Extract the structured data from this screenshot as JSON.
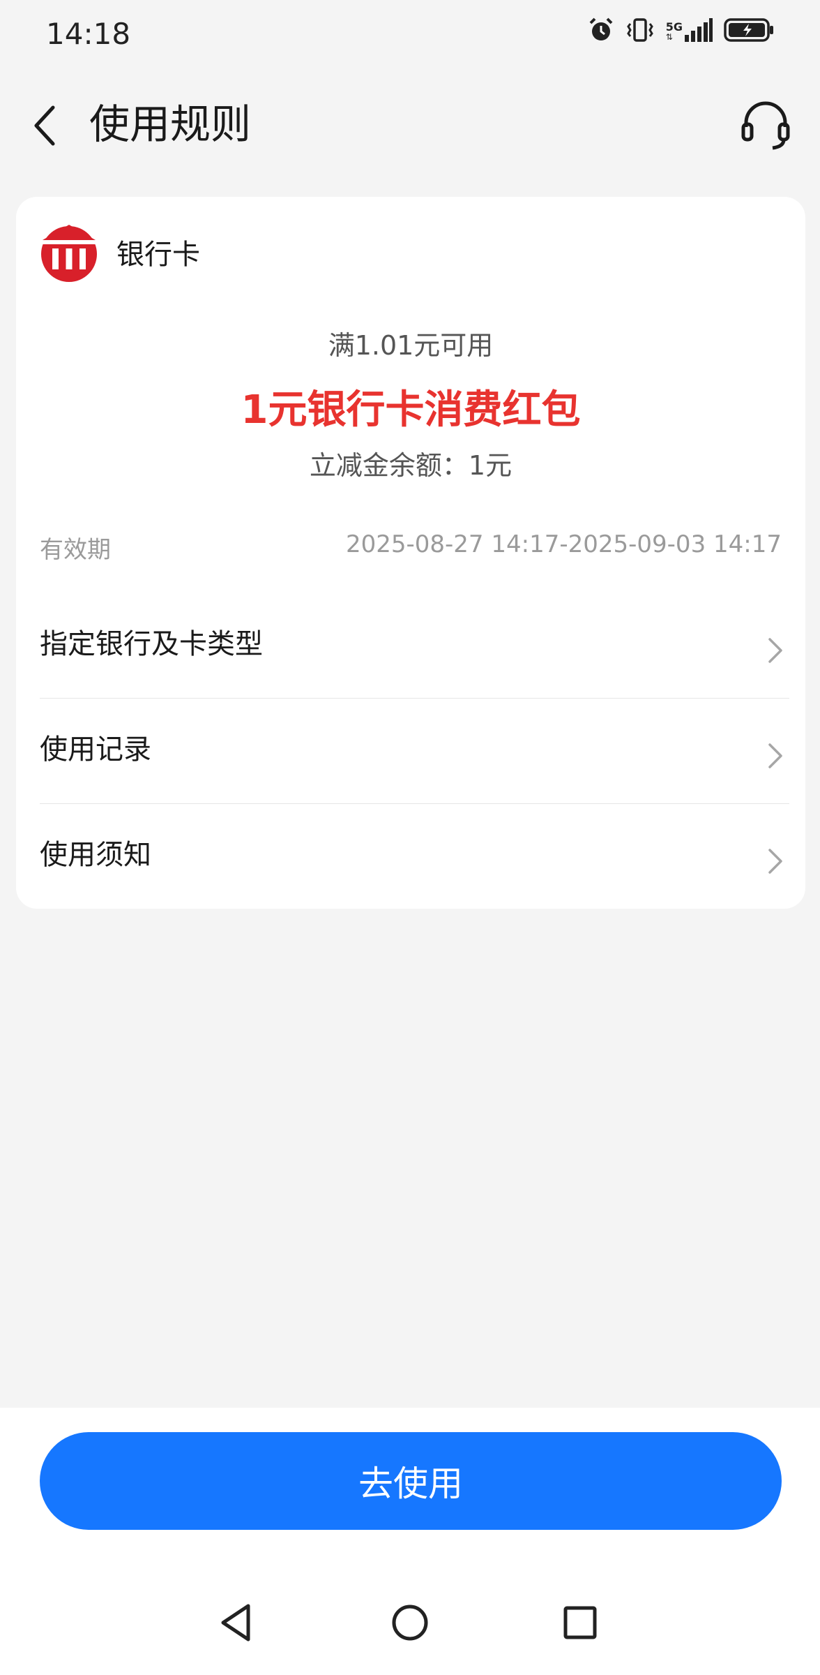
{
  "status_bar": {
    "time": "14:18",
    "network": "5G",
    "icons": [
      "alarm-icon",
      "vibrate-icon",
      "signal-icon",
      "battery-charging-icon"
    ]
  },
  "header": {
    "title": "使用规则",
    "back_icon": "chevron-left-icon",
    "service_icon": "headset-icon"
  },
  "card": {
    "type_label": "银行卡",
    "threshold": "满1.01元可用",
    "coupon_title": "1元银行卡消费红包",
    "balance": "立减金余额：1元",
    "validity_label": "有效期",
    "validity_value": "2025-08-27 14:17-2025-09-03 14:17"
  },
  "menu": [
    {
      "label": "指定银行及卡类型"
    },
    {
      "label": "使用记录"
    },
    {
      "label": "使用须知"
    }
  ],
  "primary_button": "去使用",
  "colors": {
    "accent": "#1677ff",
    "coupon_red": "#e8332f",
    "bank_icon_red": "#d8202a",
    "background": "#f4f4f4"
  }
}
